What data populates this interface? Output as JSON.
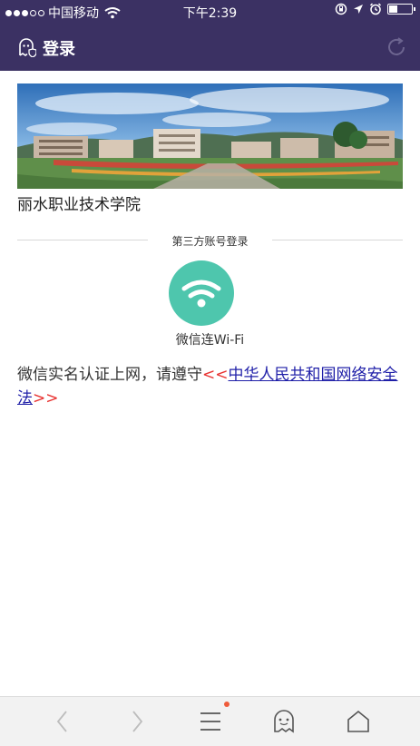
{
  "statusbar": {
    "carrier": "中国移动",
    "time": "下午2:39"
  },
  "titlebar": {
    "title": "登录"
  },
  "content": {
    "school_name": "丽水职业技术学院",
    "divider_label": "第三方账号登录",
    "wifi_button_label": "微信连Wi-Fi",
    "notice_prefix": "微信实名认证上网，请遵守",
    "notice_open": "<<",
    "notice_link": "中华人民共和国网络安全法",
    "notice_close": ">>"
  },
  "bottom_nav": {
    "items": [
      "back-icon",
      "forward-icon",
      "menu-icon",
      "ghost-icon",
      "home-icon"
    ],
    "menu_has_badge": true
  },
  "colors": {
    "header_bg": "#3b3163",
    "wifi_green": "#4ec6ad",
    "link_blue": "#1f1fa8",
    "bracket_red": "#e8312f",
    "badge_red": "#ef5b3a"
  }
}
